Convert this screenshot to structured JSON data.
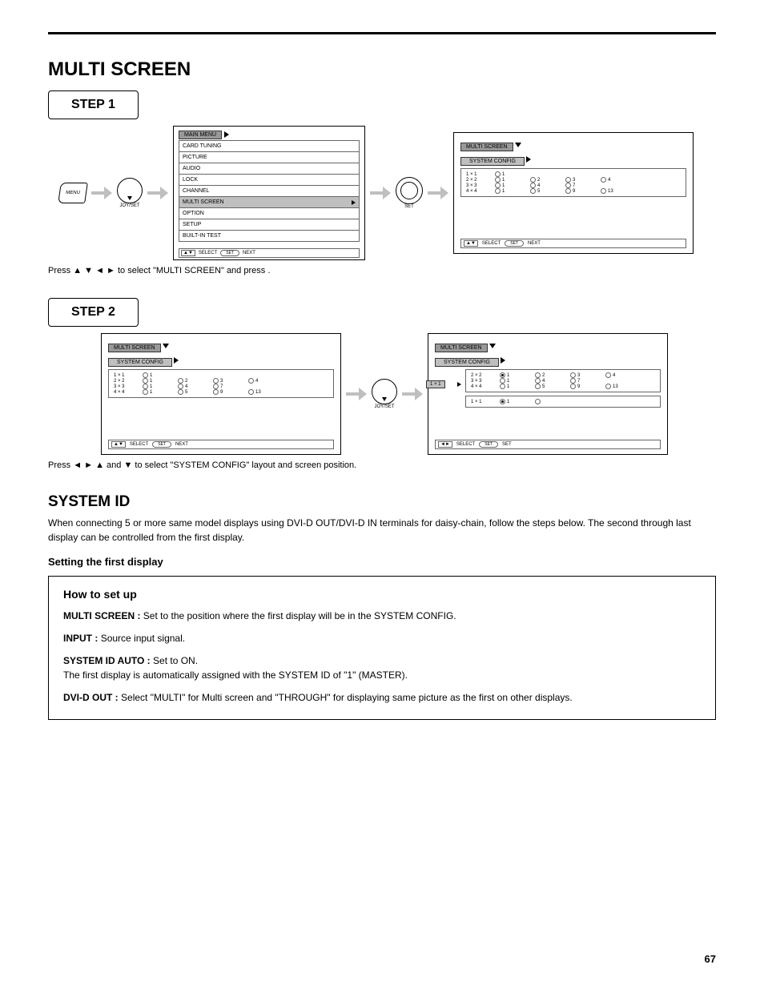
{
  "page": {
    "title": "MULTI SCREEN",
    "footer": "67"
  },
  "step1": {
    "label": "STEP 1",
    "instruction_prefix": "Press",
    "instruction_mid": "to select \"MULTI SCREEN\" and press",
    "instruction_end": ".",
    "menu_key_label": "MENU",
    "joy_label": "JOY/SET",
    "set_label": "SET",
    "main_menu_title": "MAIN  MENU",
    "items": [
      "CARD  TUNING",
      "PICTURE",
      "AUDIO",
      "LOCK",
      "CHANNEL",
      "MULTI  SCREEN",
      "OPTION",
      "SETUP",
      "BUILT-IN  TEST"
    ],
    "footer_select": "SELECT",
    "footer_next": "NEXT",
    "ms_title": "MULTI SCREEN",
    "ms_sub": "SYSTEM CONFIG",
    "ms_rows": [
      {
        "lbl": "1 × 1",
        "opts": [
          "1",
          "",
          "",
          ""
        ]
      },
      {
        "lbl": "2 × 2",
        "opts": [
          "1",
          "2",
          "3",
          "4"
        ]
      },
      {
        "lbl": "3 × 3",
        "opts": [
          "1",
          "4",
          "7",
          ""
        ]
      },
      {
        "lbl": "4 × 4",
        "opts": [
          "1",
          "5",
          "9",
          "13"
        ]
      }
    ],
    "ms_footer_select": "SELECT",
    "ms_footer_next": "NEXT"
  },
  "step2": {
    "label": "STEP 2",
    "instruction_prefix": "Press",
    "instruction_mid": "and",
    "instruction_after": "to select \"SYSTEM CONFIG\" layout and screen position.",
    "joy_label": "JOY/SET",
    "ms_title": "MULTI SCREEN",
    "ms_sub": "SYSTEM CONFIG",
    "side_label": "1 × 1",
    "left_rows": [
      {
        "lbl": "1 × 1",
        "opts": [
          "1",
          "",
          "",
          ""
        ]
      },
      {
        "lbl": "2 × 2",
        "opts": [
          "1",
          "2",
          "3",
          "4"
        ]
      },
      {
        "lbl": "3 × 3",
        "opts": [
          "1",
          "4",
          "7",
          ""
        ]
      },
      {
        "lbl": "4 × 4",
        "opts": [
          "1",
          "5",
          "9",
          "13"
        ]
      }
    ],
    "right_rows_a": [
      {
        "lbl": "2 × 2",
        "opts": [
          "1",
          "2",
          "3",
          "4"
        ],
        "sel": 0
      },
      {
        "lbl": "3 × 3",
        "opts": [
          "1",
          "4",
          "7",
          ""
        ]
      },
      {
        "lbl": "4 × 4",
        "opts": [
          "1",
          "5",
          "9",
          "13"
        ]
      }
    ],
    "right_extra": {
      "lbl": "1 × 1",
      "opts": [
        "1",
        "",
        "",
        ""
      ],
      "sel": 0
    },
    "footer_select": "SELECT",
    "footer_set": "SET"
  },
  "sys": {
    "heading": "SYSTEM ID",
    "intro": "When connecting 5 or more same model displays using DVI-D OUT/DVI-D IN terminals for daisy-chain, follow the steps below. The second through last display can be controlled from the first display.",
    "sub": "Setting the first display",
    "how_title": "How to set up",
    "items": [
      {
        "tag": "MULTI SCREEN :",
        "text": "Set to the position where the first display will be in the SYSTEM CONFIG."
      },
      {
        "tag": "INPUT :",
        "text": "Source input signal."
      },
      {
        "tag": "SYSTEM ID AUTO :",
        "text": "Set to ON.\nThe first display is automatically assigned with the SYSTEM ID of \"1\" (MASTER)."
      },
      {
        "tag": "DVI-D OUT :",
        "text": "Select \"MULTI\" for Multi screen and \"THROUGH\" for displaying same picture as the first on other displays."
      }
    ]
  }
}
